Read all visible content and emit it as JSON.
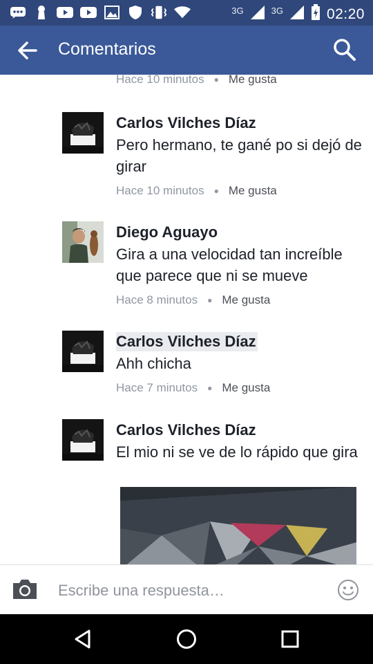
{
  "status_bar": {
    "network_1": "3G",
    "network_2": "3G",
    "time": "02:20",
    "icons": [
      "messenger-icon",
      "keyhole-icon",
      "youtube-icon",
      "youtube-icon",
      "gallery-icon",
      "shield-icon",
      "vibrate-icon",
      "wifi-icon",
      "signal-icon",
      "signal-icon",
      "battery-charging-icon"
    ]
  },
  "app_bar": {
    "title": "Comentarios",
    "back_icon": "arrow-left-icon",
    "search_icon": "search-icon"
  },
  "top_partial": {
    "time": "Hace 10 minutos",
    "like": "Me gusta"
  },
  "comments": [
    {
      "author": "Carlos Vilches Díaz",
      "text": "Pero hermano, te gané po si dejó de girar",
      "time": "Hace 10 minutos",
      "like": "Me gusta"
    },
    {
      "author": "Diego Aguayo",
      "text": "Gira a una velocidad tan increíble que parece que ni se mueve",
      "time": "Hace 8 minutos",
      "like": "Me gusta"
    },
    {
      "author": "Carlos Vilches Díaz",
      "text": "Ahh chicha",
      "time": "Hace 7 minutos",
      "like": "Me gusta"
    },
    {
      "author": "Carlos Vilches Díaz",
      "text": "El mio ni se ve de lo rápido que gira"
    }
  ],
  "reply": {
    "placeholder": "Escribe una respuesta…",
    "camera_icon": "camera-icon",
    "emoji_icon": "emoji-icon"
  },
  "nav_bar": {
    "icons": [
      "triangle-back-icon",
      "circle-home-icon",
      "square-recents-icon"
    ]
  },
  "colors": {
    "status_bar": "#2f477a",
    "app_bar": "#3b5998",
    "meta_text": "#9097a3",
    "body_text": "#1d2129"
  }
}
